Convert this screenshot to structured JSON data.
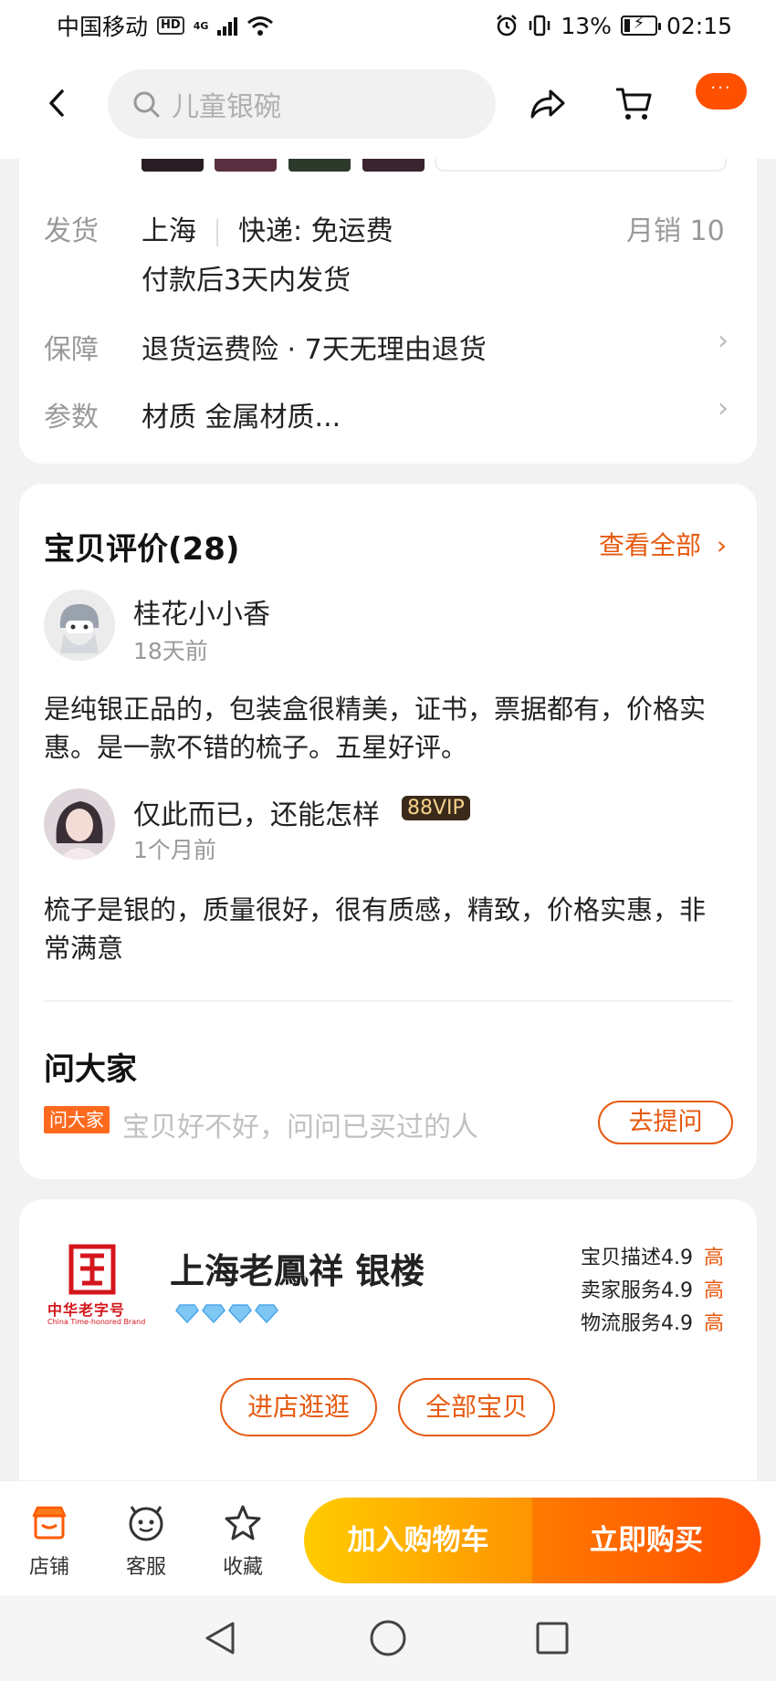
{
  "status_bar": {
    "carrier": "中国移动",
    "hd": "HD",
    "network": "4G",
    "battery": "13%",
    "time": "02:15"
  },
  "header": {
    "search_placeholder": "儿童银碗",
    "more": "···"
  },
  "delivery": {
    "ship_label": "发货",
    "origin": "上海",
    "express": "快递: 免运费",
    "monthly_sales": "月销  10",
    "ship_time": "付款后3天内发货",
    "guarantee_label": "保障",
    "guarantee_text": "退货运费险 · 7天无理由退货",
    "params_label": "参数",
    "params_text": "材质 金属材质..."
  },
  "reviews": {
    "title": "宝贝评价(28)",
    "see_all": "查看全部",
    "items": [
      {
        "user": "桂花小小香",
        "date": "18天前",
        "text": "是纯银正品的，包装盒很精美，证书，票据都有，价格实惠。是一款不错的梳子。五星好评。"
      },
      {
        "user": "仅此而已，还能怎样",
        "badge": "88VIP",
        "date": "1个月前",
        "text": "梳子是银的，质量很好，很有质感，精致，价格实惠，非常满意"
      }
    ]
  },
  "ask": {
    "title": "问大家",
    "tag": "问大家",
    "placeholder": "宝贝好不好，问问已买过的人",
    "button": "去提问"
  },
  "shop": {
    "logo_text": "中华老字号",
    "logo_subtext": "China Time-honored Brand",
    "name": "上海老鳳祥 银楼",
    "ratings": [
      {
        "label": "宝贝描述",
        "score": "4.9",
        "level": "高"
      },
      {
        "label": "卖家服务",
        "score": "4.9",
        "level": "高"
      },
      {
        "label": "物流服务",
        "score": "4.9",
        "level": "高"
      }
    ],
    "enter_button": "进店逛逛",
    "all_items_button": "全部宝贝"
  },
  "bottom_bar": {
    "tabs": [
      {
        "label": "店铺",
        "icon": "store-icon"
      },
      {
        "label": "客服",
        "icon": "customer-service-icon"
      },
      {
        "label": "收藏",
        "icon": "star-icon"
      }
    ],
    "add_to_cart": "加入购物车",
    "buy_now": "立即购买"
  },
  "colors": {
    "accent": "#e65a10",
    "brand_orange": "#ff5000",
    "cart_yellow": "#ffcb00",
    "buy_orange": "#ff4e00"
  }
}
